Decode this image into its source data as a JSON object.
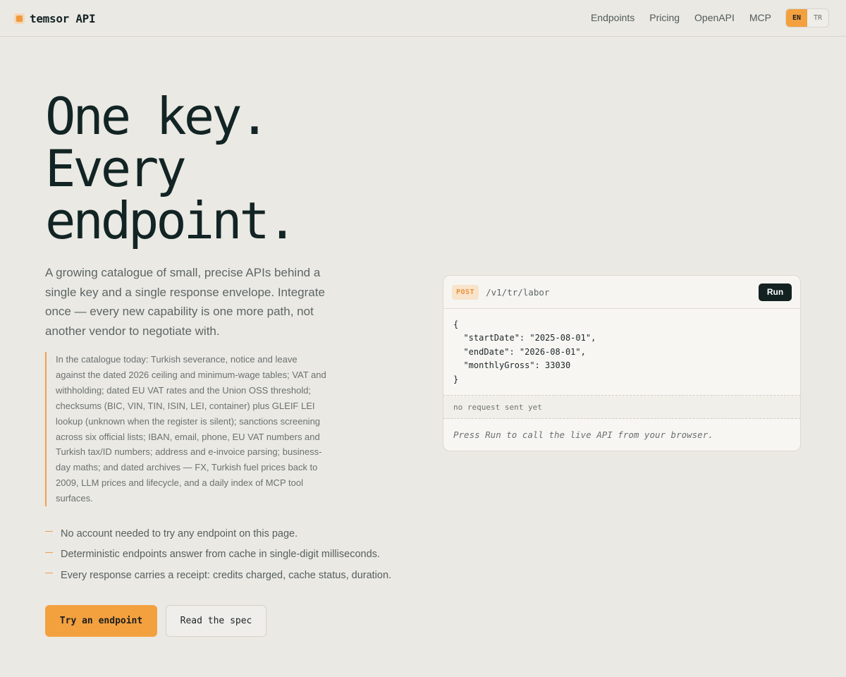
{
  "brand": {
    "name": "temsor API",
    "logo_icon": "square-logo-icon",
    "accent": "#f3a03f"
  },
  "nav": {
    "links": [
      "Endpoints",
      "Pricing",
      "OpenAPI",
      "MCP"
    ],
    "languages": {
      "active": "EN",
      "inactive": "TR"
    }
  },
  "hero": {
    "headline": [
      "One key.",
      "Every",
      "endpoint."
    ],
    "lede": "A growing catalogue of small, precise APIs behind a single key and a single response envelope. Integrate once — every new capability is one more path, not another vendor to negotiate with.",
    "catalog": "In the catalogue today: Turkish severance, notice and leave against the dated 2026 ceiling and minimum-wage tables; VAT and withholding; dated EU VAT rates and the Union OSS threshold; checksums (BIC, VIN, TIN, ISIN, LEI, container) plus GLEIF LEI lookup (unknown when the register is silent); sanctions screening across six official lists; IBAN, email, phone, EU VAT numbers and Turkish tax/ID numbers; address and e-invoice parsing; business-day maths; and dated archives — FX, Turkish fuel prices back to 2009, LLM prices and lifecycle, and a daily index of MCP tool surfaces.",
    "points": [
      "No account needed to try any endpoint on this page.",
      "Deterministic endpoints answer from cache in single-digit milliseconds.",
      "Every response carries a receipt: credits charged, cache status, duration."
    ],
    "primary_cta": "Try an endpoint",
    "secondary_cta": "Read the spec"
  },
  "console": {
    "method": "POST",
    "path": "/v1/tr/labor",
    "run_label": "Run",
    "body": "{\n  \"startDate\": \"2025-08-01\",\n  \"endDate\": \"2026-08-01\",\n  \"monthlyGross\": 33030\n}",
    "status": "no request sent yet",
    "output_hint": "Press Run to call the live API from your browser."
  }
}
